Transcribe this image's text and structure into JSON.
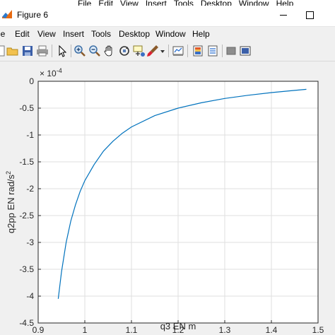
{
  "window": {
    "title": "Figure 6",
    "background_menu_items": [
      "File",
      "Edit",
      "View",
      "Insert",
      "Tools",
      "Desktop",
      "Window",
      "Help"
    ]
  },
  "menubar": {
    "items": [
      "le",
      "Edit",
      "View",
      "Insert",
      "Tools",
      "Desktop",
      "Window",
      "Help"
    ]
  },
  "toolbar": {
    "buttons": [
      "new-figure-icon",
      "open-folder-icon",
      "save-icon",
      "print-icon",
      "pointer-icon",
      "zoom-in-icon",
      "zoom-out-icon",
      "pan-hand-icon",
      "rotate-3d-icon",
      "data-cursor-icon",
      "brush-icon",
      "dropdown-arrow-icon",
      "link-plot-icon",
      "colorbar-icon",
      "legend-icon",
      "hide-plot-tools-icon",
      "show-plot-tools-icon"
    ]
  },
  "axes": {
    "xlabel": "q3 EN m",
    "ylabel_main": "q2pp EN rad/s",
    "ylabel_sup": "2",
    "exponent_base": "× 10",
    "exponent_power": "-4",
    "x_ticks": [
      "0.9",
      "1",
      "1.1",
      "1.2",
      "1.3",
      "1.4",
      "1.5"
    ],
    "y_ticks": [
      "0",
      "-0.5",
      "-1",
      "-1.5",
      "-2",
      "-2.5",
      "-3",
      "-3.5",
      "-4",
      "-4.5"
    ]
  },
  "chart_data": {
    "type": "line",
    "title": "",
    "xlabel": "q3 EN m",
    "ylabel": "q2pp EN rad/s^2",
    "xlim": [
      0.9,
      1.5
    ],
    "ylim": [
      -4.5,
      0
    ],
    "y_scale_factor": "1e-4",
    "grid": true,
    "line_color": "#0072bd",
    "series": [
      {
        "x": [
          0.943,
          0.95,
          0.96,
          0.97,
          0.98,
          0.99,
          1.0,
          1.02,
          1.04,
          1.06,
          1.08,
          1.1,
          1.15,
          1.2,
          1.25,
          1.3,
          1.35,
          1.4,
          1.45,
          1.475
        ],
        "y": [
          -4.05,
          -3.55,
          -3.0,
          -2.6,
          -2.3,
          -2.05,
          -1.85,
          -1.55,
          -1.3,
          -1.12,
          -0.97,
          -0.85,
          -0.64,
          -0.5,
          -0.4,
          -0.32,
          -0.26,
          -0.21,
          -0.17,
          -0.15
        ]
      }
    ]
  }
}
